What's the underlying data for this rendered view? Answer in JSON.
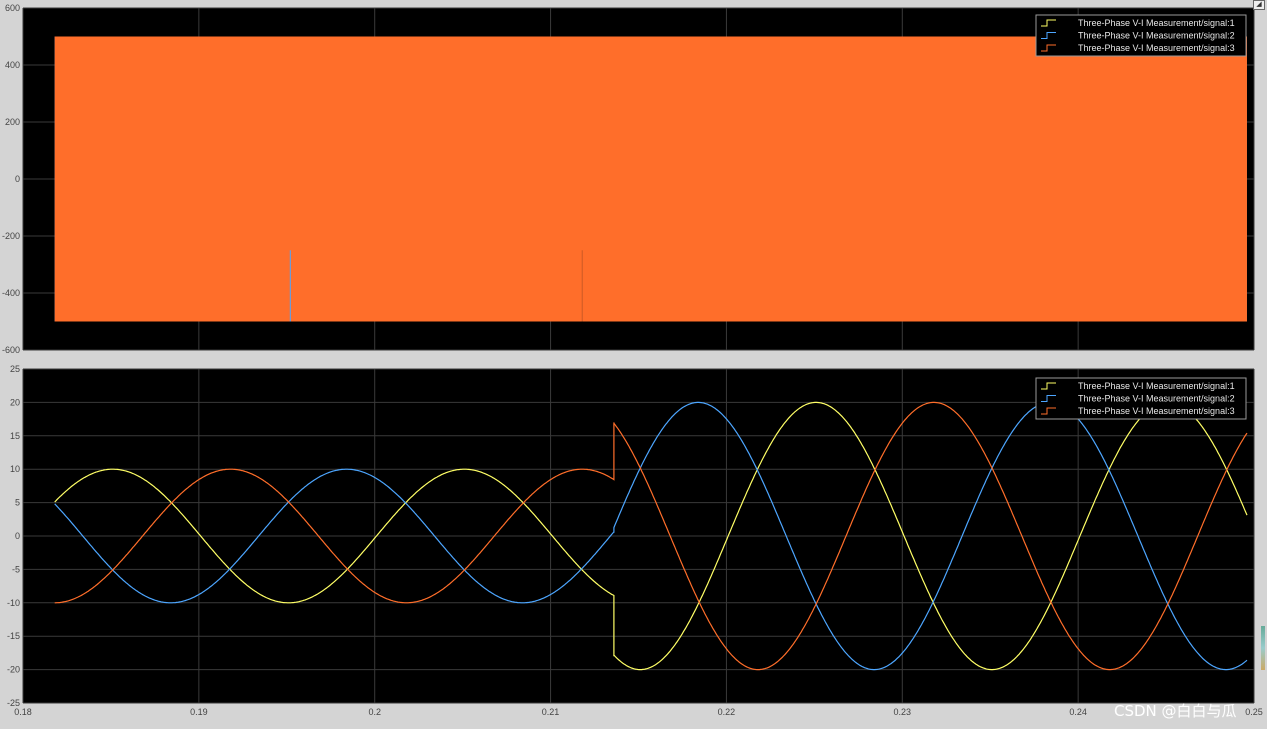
{
  "window": {
    "corner_glyph": "◢",
    "watermark": "CSDN @白白与瓜"
  },
  "colors": {
    "background": "#000000",
    "frame": "#d4d4d4",
    "grid": "#3a3a3a",
    "signal1": "#ffff66",
    "signal2": "#4da6ff",
    "signal3": "#ff6e2a"
  },
  "chart_data": [
    {
      "type": "line",
      "title": "",
      "xlabel": "",
      "ylabel": "",
      "xlim": [
        0.18,
        0.25
      ],
      "ylim": [
        -600,
        600
      ],
      "yticks": [
        "600",
        "400",
        "200",
        "0",
        "-200",
        "-400",
        "-600"
      ],
      "grid": true,
      "legend_position": "top-right",
      "series": [
        {
          "name": "Three-Phase V-I Measurement/signal:1",
          "description": "PWM switching voltage, rapid alternation between +500 and -500",
          "range": [
            -500,
            500
          ],
          "x_span": [
            0.1818,
            0.2496
          ]
        },
        {
          "name": "Three-Phase V-I Measurement/signal:2",
          "description": "PWM switching voltage, rapid alternation between +500 and -500",
          "range": [
            -500,
            500
          ],
          "x_span": [
            0.1818,
            0.2496
          ]
        },
        {
          "name": "Three-Phase V-I Measurement/signal:3",
          "description": "PWM switching voltage, rapid alternation between +500 and -500",
          "range": [
            -500,
            500
          ],
          "x_span": [
            0.1818,
            0.2496
          ]
        }
      ]
    },
    {
      "type": "line",
      "title": "",
      "xlabel": "",
      "ylabel": "",
      "xlim": [
        0.18,
        0.25
      ],
      "ylim": [
        -25,
        25
      ],
      "xticks": [
        "0.18",
        "0.19",
        "0.2",
        "0.21",
        "0.22",
        "0.23",
        "0.24",
        "0.25"
      ],
      "yticks": [
        "25",
        "20",
        "15",
        "10",
        "5",
        "0",
        "-5",
        "-10",
        "-15",
        "-20",
        "-25"
      ],
      "grid": true,
      "legend_position": "top-right",
      "frequency_hz": 50,
      "step_time": 0.2136,
      "amplitude_before": 10,
      "amplitude_after": 20,
      "x_span": [
        0.1818,
        0.2496
      ],
      "series": [
        {
          "name": "Three-Phase V-I Measurement/signal:1",
          "color": "#ffff66",
          "peaks_before": [
            [
              0.1851,
              10
            ],
            [
              0.1951,
              -10
            ],
            [
              0.2051,
              10
            ]
          ],
          "peaks_after": [
            [
              0.2251,
              20
            ],
            [
              0.2351,
              -20
            ],
            [
              0.2451,
              20
            ]
          ],
          "values_at_step": [
            -9,
            -18
          ]
        },
        {
          "name": "Three-Phase V-I Measurement/signal:2",
          "color": "#4da6ff",
          "peaks_before": [
            [
              0.1884,
              -10
            ],
            [
              0.1984,
              10
            ],
            [
              0.2084,
              -10
            ]
          ],
          "peaks_after": [
            [
              0.2184,
              20
            ],
            [
              0.2284,
              -20
            ],
            [
              0.2384,
              20
            ],
            [
              0.2484,
              -20
            ]
          ],
          "values_at_step": [
            0.5,
            1
          ]
        },
        {
          "name": "Three-Phase V-I Measurement/signal:3",
          "color": "#ff6e2a",
          "peaks_before": [
            [
              0.1818,
              -10
            ],
            [
              0.1918,
              10
            ],
            [
              0.2018,
              -10
            ],
            [
              0.2118,
              10
            ]
          ],
          "peaks_after": [
            [
              0.2218,
              -20
            ],
            [
              0.2318,
              20
            ],
            [
              0.2418,
              -20
            ]
          ],
          "values_at_step": [
            8.5,
            17
          ]
        }
      ]
    }
  ]
}
